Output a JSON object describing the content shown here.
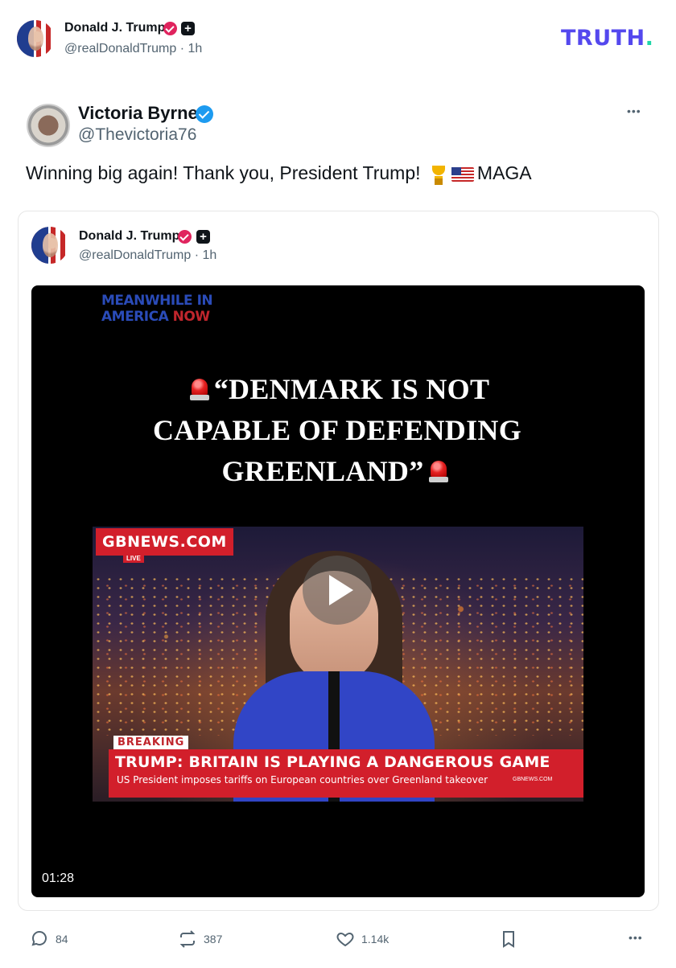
{
  "header": {
    "author_name": "Donald J. Trump",
    "author_handle": "@realDonaldTrump",
    "time": "· 1h",
    "brand_logo": "TRUTH",
    "brand_logo_dot": "."
  },
  "post": {
    "author_name": "Victoria Byrne",
    "author_handle": "@Thevictoria76",
    "text_before_emoji": "Winning big again! Thank you, President Trump! ",
    "text_after_emoji": "MAGA",
    "emoji_icons": [
      "trophy-icon",
      "us-flag-icon"
    ],
    "more_label": "•••"
  },
  "quoted": {
    "author_name": "Donald J. Trump",
    "author_handle": "@realDonaldTrump",
    "time": "· 1h"
  },
  "video": {
    "brand_line1": "MEANWHILE IN",
    "brand_line2_a": "AMERICA ",
    "brand_line2_b": "NOW",
    "headline_line1": "“DENMARK IS NOT",
    "headline_line2": "CAPABLE OF DEFENDING",
    "headline_line3": "GREENLAND”",
    "channel_logo": "GBNEWS.COM",
    "live_tag": "LIVE",
    "breaking_label": "BREAKING",
    "lower_title": "TRUMP: BRITAIN IS PLAYING A DANGEROUS GAME",
    "lower_sub": "US President imposes tariffs on European countries over Greenland takeover",
    "lower_site": "GBNEWS.COM",
    "duration": "01:28"
  },
  "actions": {
    "replies": "84",
    "retruths": "387",
    "likes": "1.14k",
    "more_label": "•••"
  },
  "colors": {
    "brand_purple": "#5448ee",
    "brand_teal": "#1ed6a8",
    "verified_blue": "#1d9bf0",
    "verified_red": "#e0245e",
    "text_secondary": "#536471",
    "news_red": "#d21f2b"
  }
}
